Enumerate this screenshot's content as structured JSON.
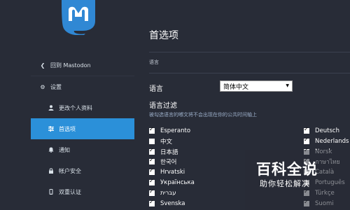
{
  "sidebar": {
    "back_label": "回到 Mastodon",
    "settings_label": "设置",
    "items": [
      {
        "label": "更改个人资料",
        "icon": "user-icon"
      },
      {
        "label": "首选项",
        "icon": "sliders-icon",
        "active": true
      },
      {
        "label": "通知",
        "icon": "bell-icon"
      },
      {
        "label": "帐户安全",
        "icon": "lock-icon"
      },
      {
        "label": "双重认证",
        "icon": "mobile-icon"
      }
    ]
  },
  "main": {
    "title": "首选项",
    "section_heading": "语言",
    "language_label": "语言",
    "language_value": "简体中文",
    "filter_title": "语言过滤",
    "filter_hint": "被勾选语言的嘟文将不会出现在你的公共时间轴上",
    "left_languages": [
      {
        "label": "Esperanto",
        "checked": true
      },
      {
        "label": "中文",
        "checked": false
      },
      {
        "label": "日本語",
        "checked": true
      },
      {
        "label": "한국어",
        "checked": true
      },
      {
        "label": "Hrvatski",
        "checked": true
      },
      {
        "label": "Українська",
        "checked": true
      },
      {
        "label": "עברית",
        "checked": true
      },
      {
        "label": "Svenska",
        "checked": true
      }
    ],
    "right_languages": [
      {
        "label": "Deutsch",
        "checked": true
      },
      {
        "label": "Nederlands",
        "checked": true
      },
      {
        "label": "Norsk",
        "checked": true
      },
      {
        "label": "ภาษาไทย",
        "checked": true
      },
      {
        "label": "Català",
        "checked": true
      },
      {
        "label": "Português",
        "checked": true
      },
      {
        "label": "Türkçe",
        "checked": true
      },
      {
        "label": "Suomi",
        "checked": true
      }
    ]
  },
  "watermark": {
    "big": "百科全说",
    "small": "助你轻松解决"
  },
  "colors": {
    "accent": "#2b90d9",
    "background": "#282c37"
  }
}
